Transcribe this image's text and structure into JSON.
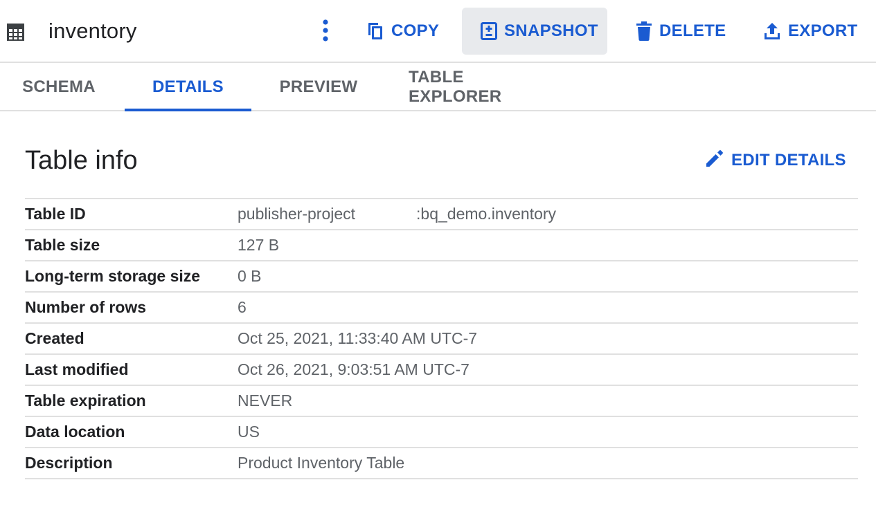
{
  "header": {
    "title": "inventory",
    "actions": {
      "copy": "COPY",
      "snapshot": "SNAPSHOT",
      "delete": "DELETE",
      "export": "EXPORT"
    }
  },
  "tabs": [
    {
      "label": "SCHEMA",
      "active": false
    },
    {
      "label": "DETAILS",
      "active": true
    },
    {
      "label": "PREVIEW",
      "active": false
    },
    {
      "label": "TABLE EXPLORER",
      "active": false
    }
  ],
  "section": {
    "title": "Table info",
    "edit_label": "EDIT DETAILS"
  },
  "info": [
    {
      "label": "Table ID",
      "value_prefix": "publisher-project",
      "value_suffix": ":bq_demo.inventory"
    },
    {
      "label": "Table size",
      "value": "127 B"
    },
    {
      "label": "Long-term storage size",
      "value": "0 B"
    },
    {
      "label": "Number of rows",
      "value": "6"
    },
    {
      "label": "Created",
      "value": "Oct 25, 2021, 11:33:40 AM UTC-7"
    },
    {
      "label": "Last modified",
      "value": "Oct 26, 2021, 9:03:51 AM UTC-7"
    },
    {
      "label": "Table expiration",
      "value": "NEVER"
    },
    {
      "label": "Data location",
      "value": "US"
    },
    {
      "label": "Description",
      "value": "Product Inventory Table"
    }
  ],
  "colors": {
    "accent": "#1a5bd1",
    "text": "#202124",
    "muted": "#5f6368",
    "divider": "#e0e0e0",
    "active_button_bg": "#e8eaed"
  },
  "icons": {
    "table": "table-grid-icon",
    "more": "more-vert-icon",
    "copy": "copy-icon",
    "snapshot": "snapshot-icon",
    "delete": "trash-icon",
    "export": "upload-icon",
    "edit": "pencil-icon"
  }
}
